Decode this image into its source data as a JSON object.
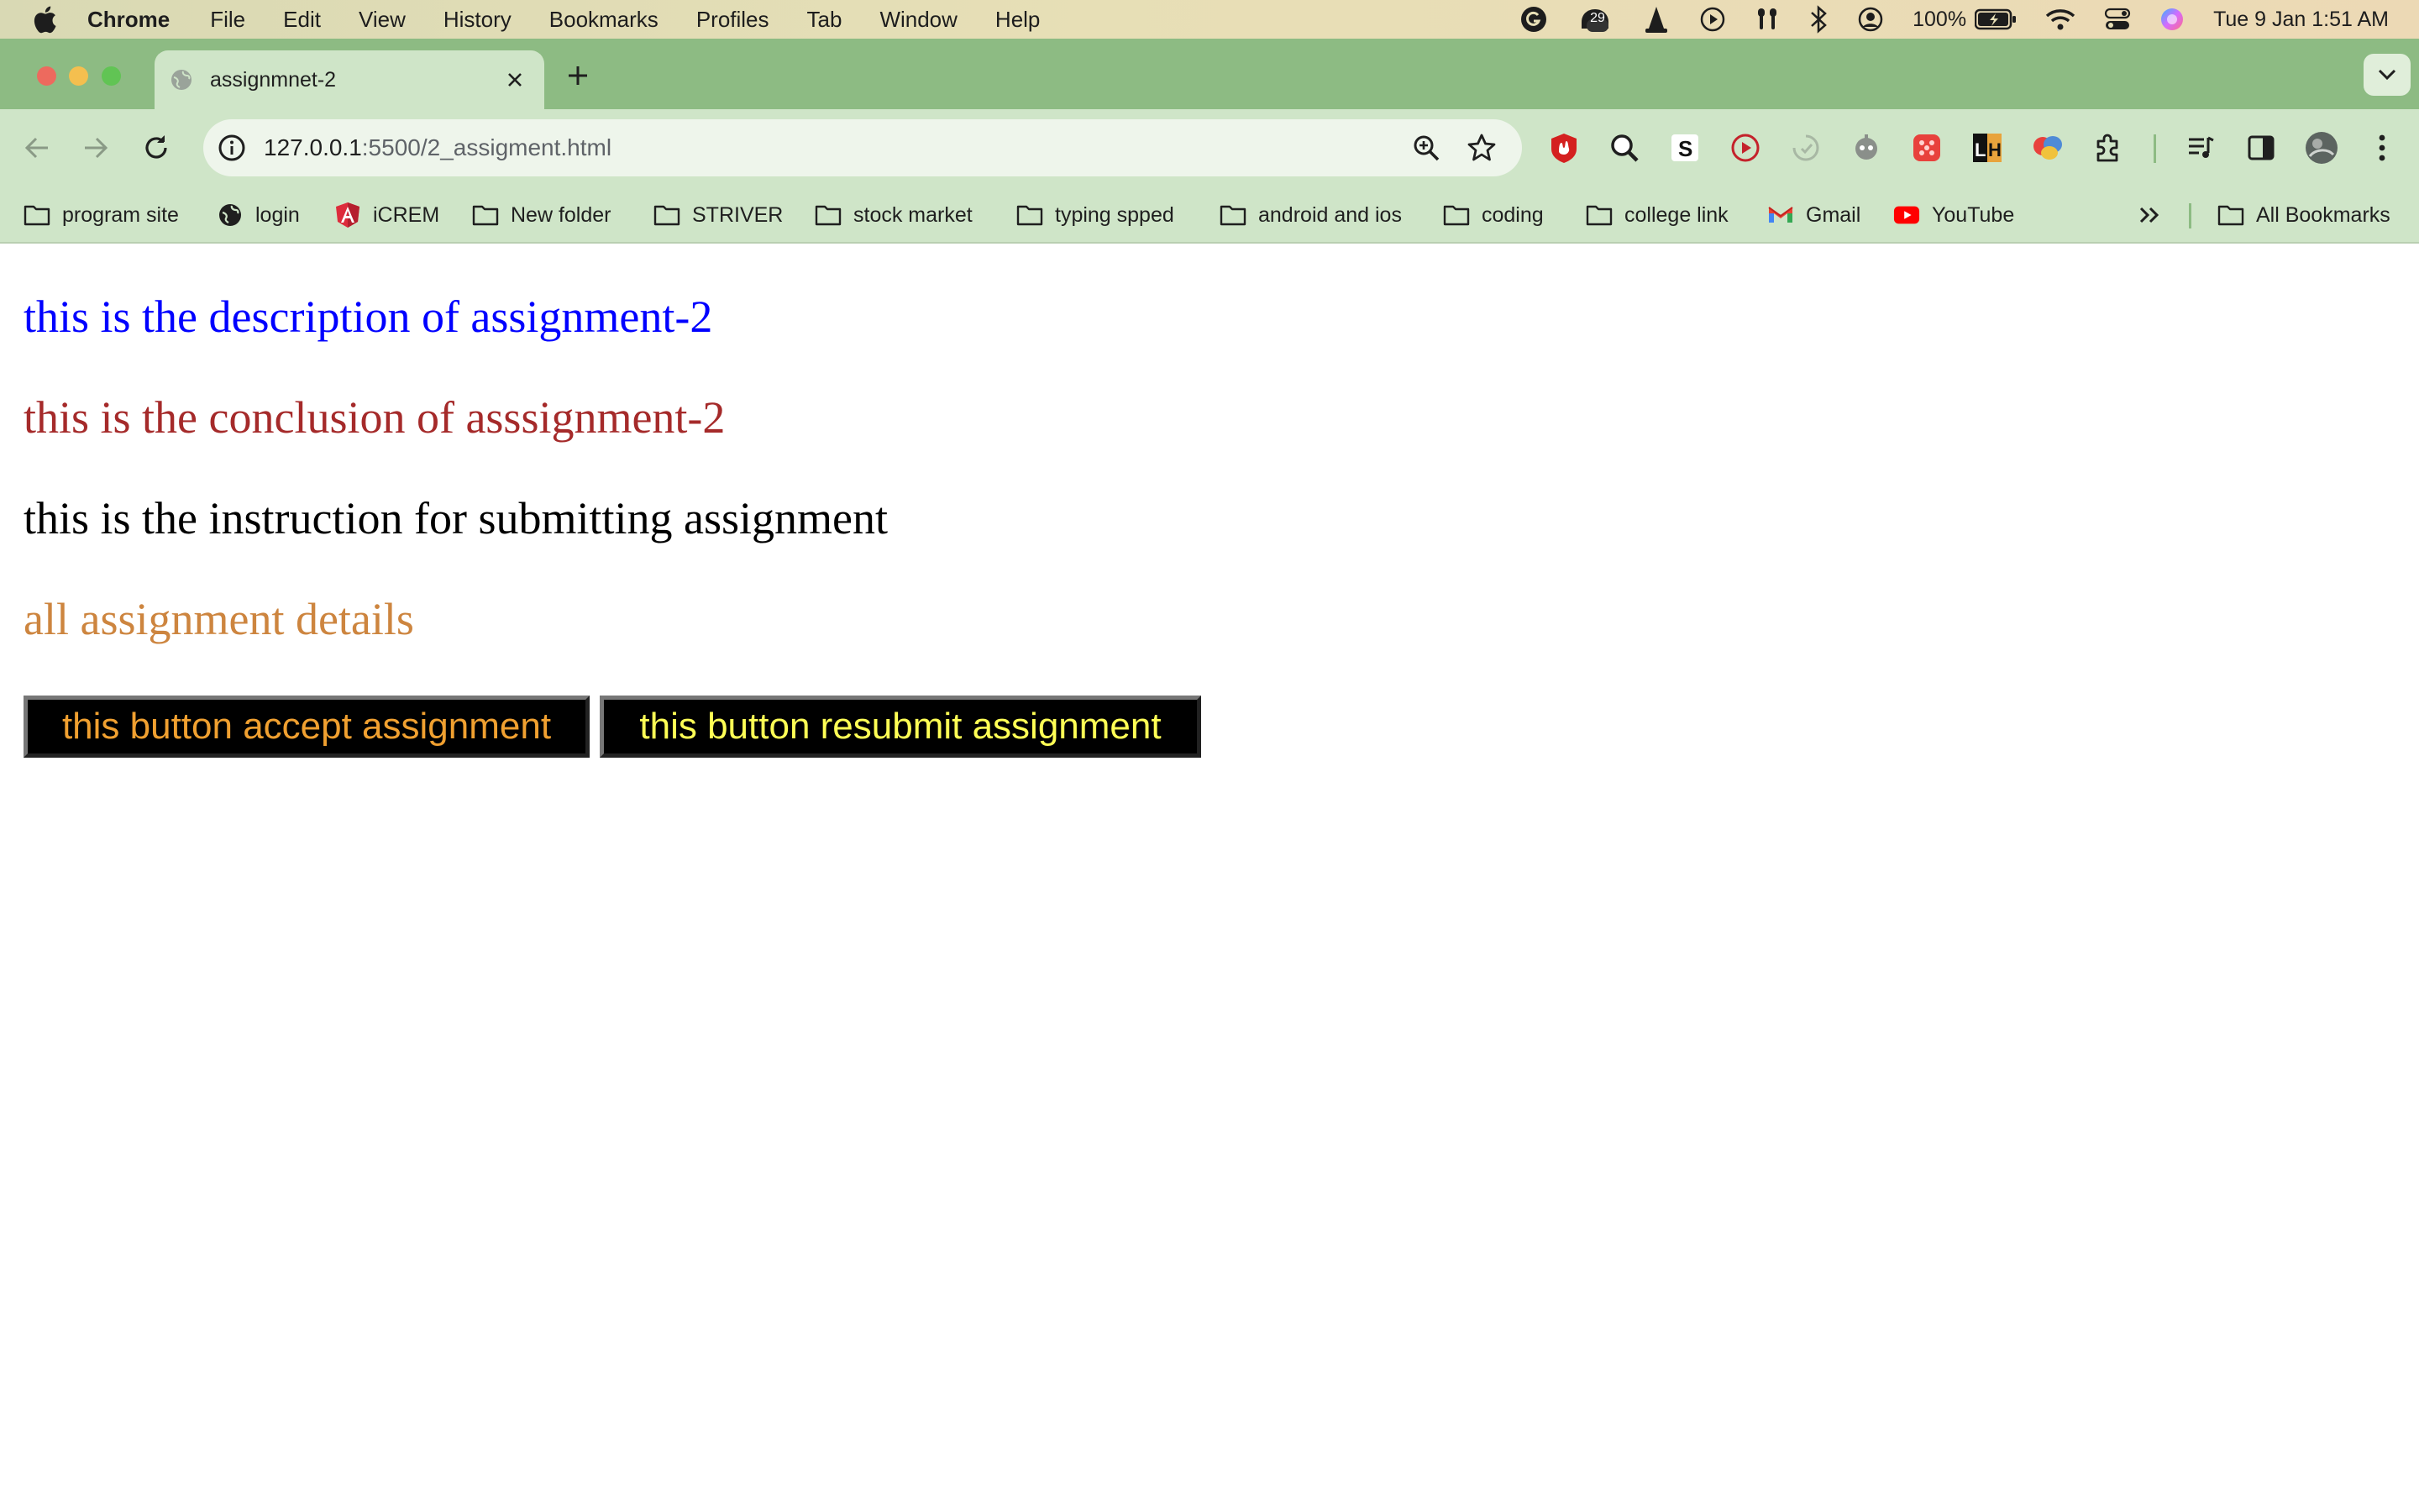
{
  "menubar": {
    "app": "Chrome",
    "items": [
      "File",
      "Edit",
      "View",
      "History",
      "Bookmarks",
      "Profiles",
      "Tab",
      "Window",
      "Help"
    ],
    "status": {
      "notification_count": "29",
      "battery": "100%",
      "datetime": "Tue 9 Jan  1:51 AM"
    }
  },
  "tab": {
    "title": "assignmnet-2"
  },
  "omnibox": {
    "url_host": "127.0.0.1",
    "url_rest": ":5500/2_assigment.html"
  },
  "bookmarks": [
    {
      "label": "program site",
      "icon": "folder-icon"
    },
    {
      "label": "login",
      "icon": "globe-icon"
    },
    {
      "label": "iCREM",
      "icon": "angular-icon"
    },
    {
      "label": "New folder",
      "icon": "folder-icon"
    },
    {
      "label": "STRIVER",
      "icon": "folder-icon"
    },
    {
      "label": "stock market",
      "icon": "folder-icon"
    },
    {
      "label": "typing spped",
      "icon": "folder-icon"
    },
    {
      "label": "android and ios",
      "icon": "folder-icon"
    },
    {
      "label": "coding",
      "icon": "folder-icon"
    },
    {
      "label": "college link",
      "icon": "folder-icon"
    },
    {
      "label": "Gmail",
      "icon": "gmail-icon"
    },
    {
      "label": "YouTube",
      "icon": "youtube-icon"
    }
  ],
  "all_bookmarks": "All Bookmarks",
  "page": {
    "description": "this is the description of assignment-2",
    "conclusion": "this is the conclusion of asssignment-2",
    "instruction": "this is the instruction for submitting assignment",
    "details": "all assignment details",
    "accept_button": "this button accept assignment",
    "resubmit_button": "this button resubmit assignment"
  },
  "colors": {
    "tabstrip": "#8dbb83",
    "toolbar": "#cfe5c8",
    "description": "#0000ff",
    "conclusion": "#a52a2a",
    "instruction": "#000000",
    "details": "#cd853f",
    "accept_text": "#f0a030",
    "resubmit_text": "#ffff55"
  }
}
